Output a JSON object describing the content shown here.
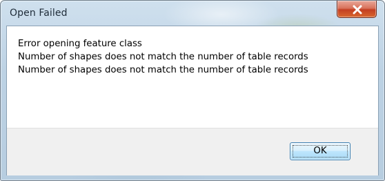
{
  "window": {
    "title": "Open Failed"
  },
  "message": {
    "lines": [
      "Error opening feature class",
      "Number of shapes does not match the number of table records",
      "Number of shapes does not match the number of table records"
    ]
  },
  "buttons": {
    "ok_label": "OK",
    "close_icon": "close-icon"
  },
  "colors": {
    "close_button": "#c43f22",
    "ok_border": "#3c7fb1",
    "footer_bg": "#f0f0f0"
  }
}
